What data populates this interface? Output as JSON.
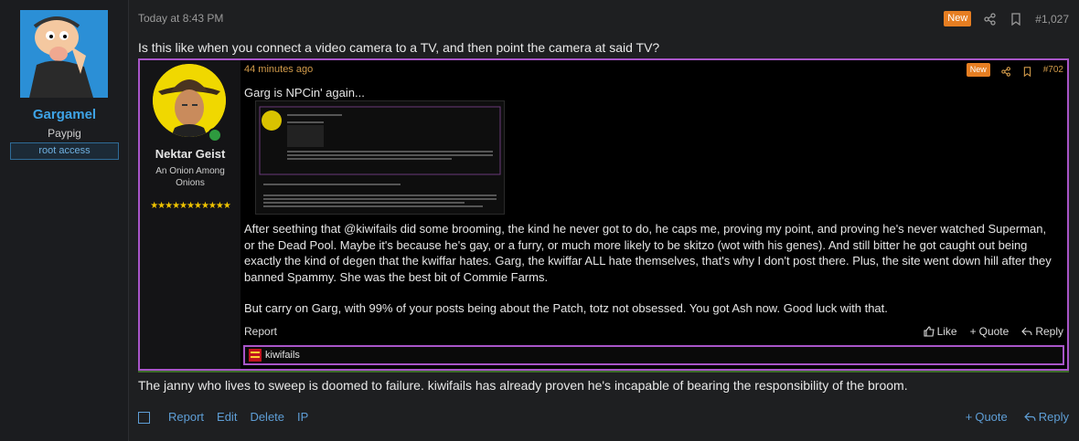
{
  "outer_user": {
    "name": "Gargamel",
    "title": "Paypig",
    "banner": "root access"
  },
  "post": {
    "date": "Today at 8:43 PM",
    "new_badge": "New",
    "number": "#1,027",
    "text_top": "Is this like when you connect a video camera to a TV, and then point the camera at said TV?",
    "text_bottom": "The janny who lives to sweep is doomed to failure. kiwifails has already proven he's incapable of bearing the responsibility of the broom."
  },
  "quote": {
    "user_name": "Nektar Geist",
    "user_title": "An Onion Among Onions",
    "stars": "★★★★★★★★★★★",
    "date": "44 minutes ago",
    "new_badge": "New",
    "number": "#702",
    "first_line": "Garg is NPCin' again...",
    "paragraph1": "After seething that @kiwifails did some brooming, the kind he never got to do, he caps me, proving my point, and proving he's never watched Superman, or the Dead Pool. Maybe it's because he's gay, or a furry, or much more likely to be skitzo (wot with his genes). And still bitter he got caught out being exactly the kind of degen that the kwiffar hates. Garg, the kwiffar ALL hate themselves, that's why I don't post there. Plus, the site went down hill after they banned Spammy. She was the best bit of Commie Farms.",
    "paragraph2": "But carry on Garg, with 99% of your posts being about the Patch, totz not obsessed. You got Ash now. Good luck with that.",
    "report": "Report",
    "like": "Like",
    "quote_label": "Quote",
    "reply": "Reply",
    "signature": "kiwifails"
  },
  "footer": {
    "report": "Report",
    "edit": "Edit",
    "delete": "Delete",
    "ip": "IP",
    "quote": "Quote",
    "reply": "Reply"
  },
  "colors": {
    "accent_blue": "#5e9ed6",
    "quote_border": "#a855c8",
    "new_badge": "#e67e22"
  }
}
